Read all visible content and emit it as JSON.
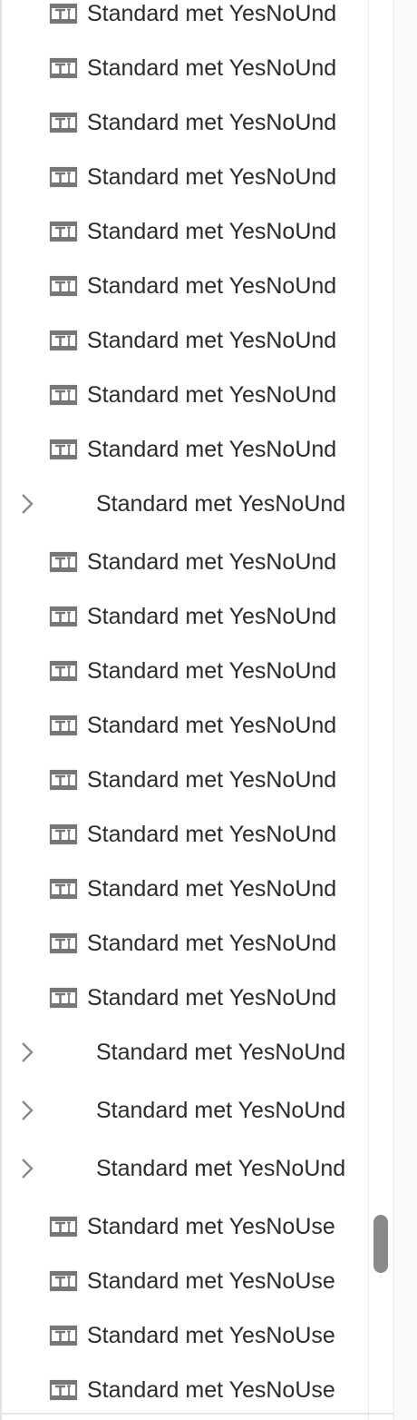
{
  "rows": [
    {
      "kind": "field",
      "label": "Standard met YesNoUnd",
      "icon": "text-field-icon"
    },
    {
      "kind": "field",
      "label": "Standard met YesNoUnd",
      "icon": "text-field-icon"
    },
    {
      "kind": "field",
      "label": "Standard met YesNoUnd",
      "icon": "text-field-icon"
    },
    {
      "kind": "field",
      "label": "Standard met YesNoUnd",
      "icon": "text-field-icon"
    },
    {
      "kind": "field",
      "label": "Standard met YesNoUnd",
      "icon": "text-field-icon"
    },
    {
      "kind": "field",
      "label": "Standard met YesNoUnd",
      "icon": "text-field-icon"
    },
    {
      "kind": "field",
      "label": "Standard met YesNoUnd",
      "icon": "text-field-icon"
    },
    {
      "kind": "field",
      "label": "Standard met YesNoUnd",
      "icon": "text-field-icon"
    },
    {
      "kind": "field",
      "label": "Standard met YesNoUnd",
      "icon": "text-field-icon"
    },
    {
      "kind": "group",
      "label": "Standard met YesNoUnd",
      "icon": "chevron-right-icon"
    },
    {
      "kind": "field",
      "label": "Standard met YesNoUnd",
      "icon": "text-field-icon"
    },
    {
      "kind": "field",
      "label": "Standard met YesNoUnd",
      "icon": "text-field-icon"
    },
    {
      "kind": "field",
      "label": "Standard met YesNoUnd",
      "icon": "text-field-icon"
    },
    {
      "kind": "field",
      "label": "Standard met YesNoUnd",
      "icon": "text-field-icon"
    },
    {
      "kind": "field",
      "label": "Standard met YesNoUnd",
      "icon": "text-field-icon"
    },
    {
      "kind": "field",
      "label": "Standard met YesNoUnd",
      "icon": "text-field-icon"
    },
    {
      "kind": "field",
      "label": "Standard met YesNoUnd",
      "icon": "text-field-icon"
    },
    {
      "kind": "field",
      "label": "Standard met YesNoUnd",
      "icon": "text-field-icon"
    },
    {
      "kind": "field",
      "label": "Standard met YesNoUnd",
      "icon": "text-field-icon"
    },
    {
      "kind": "group",
      "label": "Standard met YesNoUnd",
      "icon": "chevron-right-icon"
    },
    {
      "kind": "group",
      "label": "Standard met YesNoUnd",
      "icon": "chevron-right-icon"
    },
    {
      "kind": "group",
      "label": "Standard met YesNoUnd",
      "icon": "chevron-right-icon"
    },
    {
      "kind": "field",
      "label": "Standard met YesNoUse",
      "icon": "text-field-icon"
    },
    {
      "kind": "field",
      "label": "Standard met YesNoUse",
      "icon": "text-field-icon"
    },
    {
      "kind": "field",
      "label": "Standard met YesNoUse",
      "icon": "text-field-icon"
    },
    {
      "kind": "field",
      "label": "Standard met YesNoUse",
      "icon": "text-field-icon"
    }
  ],
  "colors": {
    "text": "#2b2b2b",
    "icon": "#777777",
    "chevron": "#8a8a8a",
    "scroll_thumb": "#8a8a8a"
  }
}
